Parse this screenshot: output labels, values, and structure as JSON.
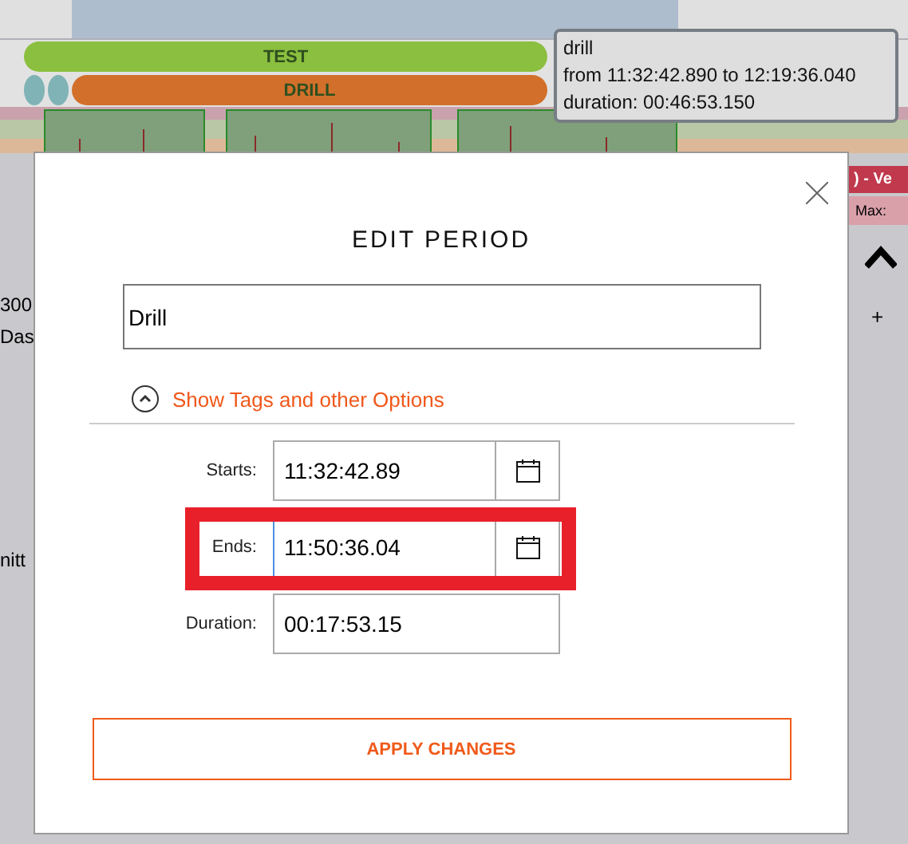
{
  "timeline": {
    "bars": [
      {
        "label": "TEST",
        "color": "#8bbf3f"
      },
      {
        "label": "DRILL",
        "color": "#d2702b"
      }
    ]
  },
  "tooltip": {
    "title": "drill",
    "range": "from 11:32:42.890 to 12:19:36.040",
    "duration": "duration: 00:46:53.150"
  },
  "left_panel": {
    "value": "300",
    "tab": "Das",
    "item": "nitt"
  },
  "right_panel": {
    "heading": ") - Ve",
    "stat": "Max:",
    "add": "+"
  },
  "dialog": {
    "title": "EDIT PERIOD",
    "name_value": "Drill",
    "options_link": "Show Tags and other Options",
    "fields": [
      {
        "label": "Starts:",
        "value": "11:32:42.89",
        "kind": "datetime",
        "highlighted": false
      },
      {
        "label": "Ends:",
        "value": "11:50:36.04",
        "kind": "datetime",
        "highlighted": true
      },
      {
        "label": "Duration:",
        "value": "00:17:53.15",
        "kind": "text",
        "highlighted": false
      }
    ],
    "apply_button": "APPLY CHANGES"
  }
}
